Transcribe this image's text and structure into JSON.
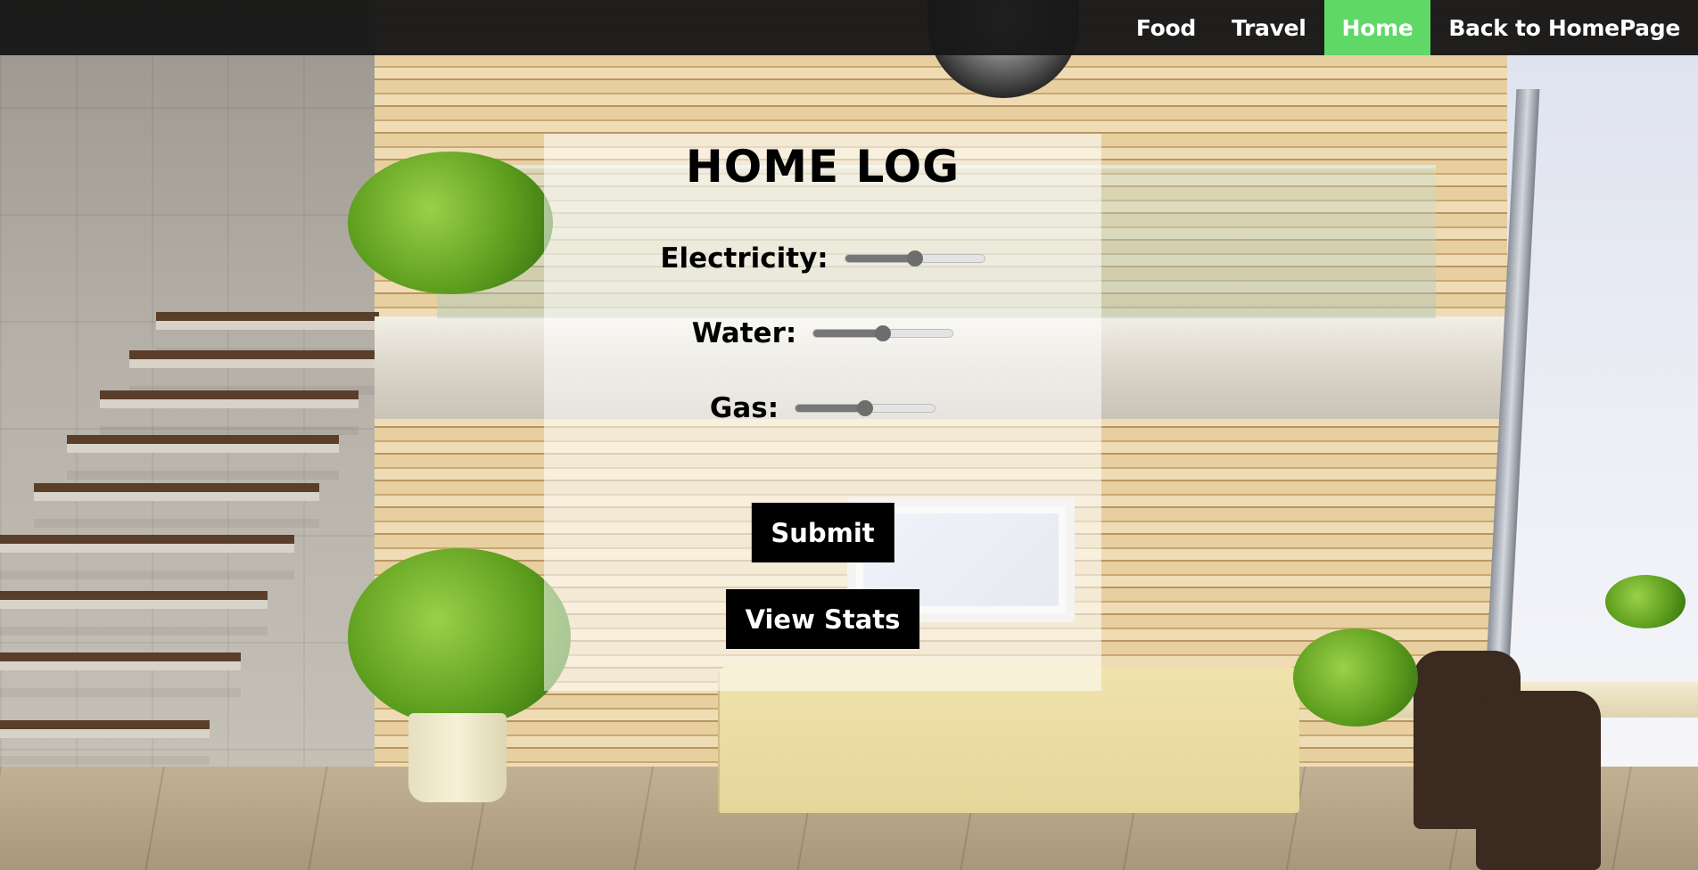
{
  "nav": {
    "items": [
      {
        "label": "Food",
        "active": false
      },
      {
        "label": "Travel",
        "active": false
      },
      {
        "label": "Home",
        "active": true
      },
      {
        "label": "Back to HomePage",
        "active": false
      }
    ],
    "active_color": "#5fd867",
    "bar_color": "#181818"
  },
  "panel": {
    "title": "HOME LOG",
    "sliders": [
      {
        "label": "Electricity:",
        "value": 0.5
      },
      {
        "label": "Water:",
        "value": 0.5
      },
      {
        "label": "Gas:",
        "value": 0.5
      }
    ],
    "submit_label": "Submit",
    "stats_label": "View Stats"
  }
}
